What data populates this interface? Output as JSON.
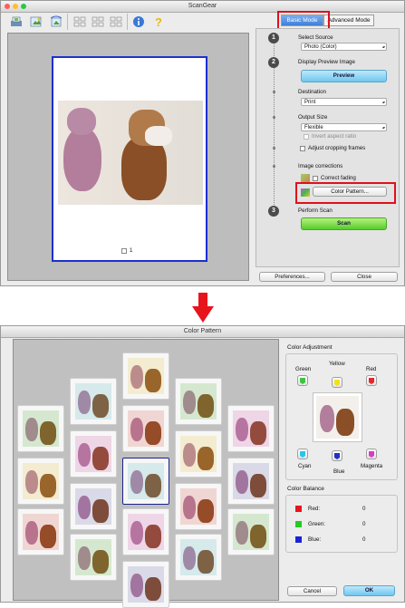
{
  "scangear": {
    "title": "ScanGear",
    "tabs": {
      "basic": "Basic Mode",
      "advanced": "Advanced Mode"
    },
    "steps": {
      "s1": {
        "number": "1",
        "label": "Select Source",
        "value": "Photo (Color)"
      },
      "s2": {
        "number": "2",
        "label": "Display Preview Image",
        "button": "Preview"
      },
      "destination": {
        "label": "Destination",
        "value": "Print"
      },
      "output": {
        "label": "Output Size",
        "value": "Flexible"
      },
      "invert_aspect": "Invert aspect ratio",
      "adjust_frames": "Adjust cropping frames",
      "corrections": {
        "label": "Image corrections",
        "correct_fading": "Correct fading",
        "color_pattern_button": "Color Pattern..."
      },
      "s3": {
        "number": "3",
        "label": "Perform Scan",
        "button": "Scan"
      }
    },
    "preview_checkbox_label": "1",
    "footer": {
      "preferences": "Preferences...",
      "close": "Close"
    }
  },
  "color_pattern": {
    "title": "Color Pattern",
    "adjustment": {
      "heading": "Color Adjustment",
      "green": "Green",
      "yellow": "Yellow",
      "red": "Red",
      "cyan": "Cyan",
      "blue": "Blue",
      "magenta": "Magenta"
    },
    "balance": {
      "heading": "Color Balance",
      "rows": [
        {
          "label": "Red:",
          "value": "0",
          "color": "#e8141c"
        },
        {
          "label": "Green:",
          "value": "0",
          "color": "#22cc22"
        },
        {
          "label": "Blue:",
          "value": "0",
          "color": "#1a22d8"
        }
      ]
    },
    "buttons": {
      "cancel": "Cancel",
      "ok": "OK"
    }
  },
  "colors": {
    "highlight": "#e0101c",
    "preview_frame": "#1c2fd0",
    "arrow": "#e8141c"
  },
  "icons": [
    "scanner-icon",
    "crop-icon",
    "rotate-icon",
    "thumbnail-icon",
    "info-icon",
    "help-icon"
  ]
}
